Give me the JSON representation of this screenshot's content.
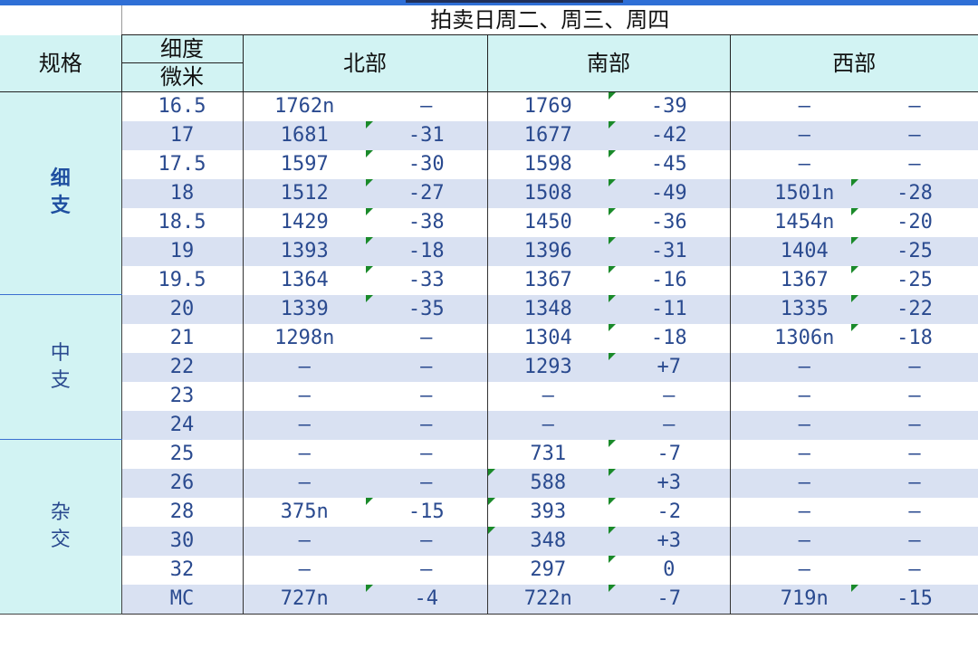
{
  "title": "拍卖日周二、周三、周四",
  "headers": {
    "spec": "规格",
    "fineness_top": "细度",
    "fineness_bottom": "微米",
    "north": "北部",
    "south": "南部",
    "west": "西部"
  },
  "groups": [
    {
      "label": "细\n支",
      "bold": true,
      "rows": 7
    },
    {
      "label": "中\n支",
      "bold": false,
      "rows": 5
    },
    {
      "label": "杂\n交",
      "bold": false,
      "rows": 6
    }
  ],
  "rows": [
    {
      "micron": "16.5",
      "north": [
        "1762n",
        "–"
      ],
      "south": [
        "1769",
        "-39"
      ],
      "west": [
        "–",
        "–"
      ],
      "flags": {
        "nc": false,
        "sp": false,
        "sc": true,
        "wc": false
      }
    },
    {
      "micron": "17",
      "north": [
        "1681",
        "-31"
      ],
      "south": [
        "1677",
        "-42"
      ],
      "west": [
        "–",
        "–"
      ],
      "flags": {
        "nc": true,
        "sp": false,
        "sc": true,
        "wc": false
      }
    },
    {
      "micron": "17.5",
      "north": [
        "1597",
        "-30"
      ],
      "south": [
        "1598",
        "-45"
      ],
      "west": [
        "–",
        "–"
      ],
      "flags": {
        "nc": true,
        "sp": false,
        "sc": true,
        "wc": false
      }
    },
    {
      "micron": "18",
      "north": [
        "1512",
        "-27"
      ],
      "south": [
        "1508",
        "-49"
      ],
      "west": [
        "1501n",
        "-28"
      ],
      "flags": {
        "nc": true,
        "sp": false,
        "sc": true,
        "wc": true
      }
    },
    {
      "micron": "18.5",
      "north": [
        "1429",
        "-38"
      ],
      "south": [
        "1450",
        "-36"
      ],
      "west": [
        "1454n",
        "-20"
      ],
      "flags": {
        "nc": true,
        "sp": false,
        "sc": true,
        "wc": true
      }
    },
    {
      "micron": "19",
      "north": [
        "1393",
        "-18"
      ],
      "south": [
        "1396",
        "-31"
      ],
      "west": [
        "1404",
        "-25"
      ],
      "flags": {
        "nc": true,
        "sp": false,
        "sc": true,
        "wc": true
      }
    },
    {
      "micron": "19.5",
      "north": [
        "1364",
        "-33"
      ],
      "south": [
        "1367",
        "-16"
      ],
      "west": [
        "1367",
        "-25"
      ],
      "flags": {
        "nc": true,
        "sp": false,
        "sc": true,
        "wc": true
      }
    },
    {
      "micron": "20",
      "north": [
        "1339",
        "-35"
      ],
      "south": [
        "1348",
        "-11"
      ],
      "west": [
        "1335",
        "-22"
      ],
      "flags": {
        "nc": true,
        "sp": false,
        "sc": true,
        "wc": true
      }
    },
    {
      "micron": "21",
      "north": [
        "1298n",
        "–"
      ],
      "south": [
        "1304",
        "-18"
      ],
      "west": [
        "1306n",
        "-18"
      ],
      "flags": {
        "nc": false,
        "sp": false,
        "sc": true,
        "wc": true
      }
    },
    {
      "micron": "22",
      "north": [
        "–",
        "–"
      ],
      "south": [
        "1293",
        "+7"
      ],
      "west": [
        "–",
        "–"
      ],
      "flags": {
        "nc": false,
        "sp": false,
        "sc": true,
        "wc": false
      }
    },
    {
      "micron": "23",
      "north": [
        "–",
        "–"
      ],
      "south": [
        "–",
        "–"
      ],
      "west": [
        "–",
        "–"
      ],
      "flags": {
        "nc": false,
        "sp": false,
        "sc": false,
        "wc": false
      }
    },
    {
      "micron": "24",
      "north": [
        "–",
        "–"
      ],
      "south": [
        "–",
        "–"
      ],
      "west": [
        "–",
        "–"
      ],
      "flags": {
        "nc": false,
        "sp": false,
        "sc": false,
        "wc": false
      }
    },
    {
      "micron": "25",
      "north": [
        "–",
        "–"
      ],
      "south": [
        "731",
        "-7"
      ],
      "west": [
        "–",
        "–"
      ],
      "flags": {
        "nc": false,
        "sp": false,
        "sc": true,
        "wc": false
      }
    },
    {
      "micron": "26",
      "north": [
        "–",
        "–"
      ],
      "south": [
        "588",
        "+3"
      ],
      "west": [
        "–",
        "–"
      ],
      "flags": {
        "nc": false,
        "sp": true,
        "sc": true,
        "wc": false
      }
    },
    {
      "micron": "28",
      "north": [
        "375n",
        "-15"
      ],
      "south": [
        "393",
        "-2"
      ],
      "west": [
        "–",
        "–"
      ],
      "flags": {
        "nc": true,
        "sp": true,
        "sc": true,
        "wc": false
      }
    },
    {
      "micron": "30",
      "north": [
        "–",
        "–"
      ],
      "south": [
        "348",
        "+3"
      ],
      "west": [
        "–",
        "–"
      ],
      "flags": {
        "nc": false,
        "sp": true,
        "sc": true,
        "wc": false
      }
    },
    {
      "micron": "32",
      "north": [
        "–",
        "–"
      ],
      "south": [
        "297",
        "0"
      ],
      "west": [
        "–",
        "–"
      ],
      "flags": {
        "nc": false,
        "sp": false,
        "sc": true,
        "wc": false
      }
    },
    {
      "micron": "MC",
      "north": [
        "727n",
        "-4"
      ],
      "south": [
        "722n",
        "-7"
      ],
      "west": [
        "719n",
        "-15"
      ],
      "flags": {
        "nc": true,
        "sp": false,
        "sc": true,
        "wc": true
      }
    }
  ]
}
